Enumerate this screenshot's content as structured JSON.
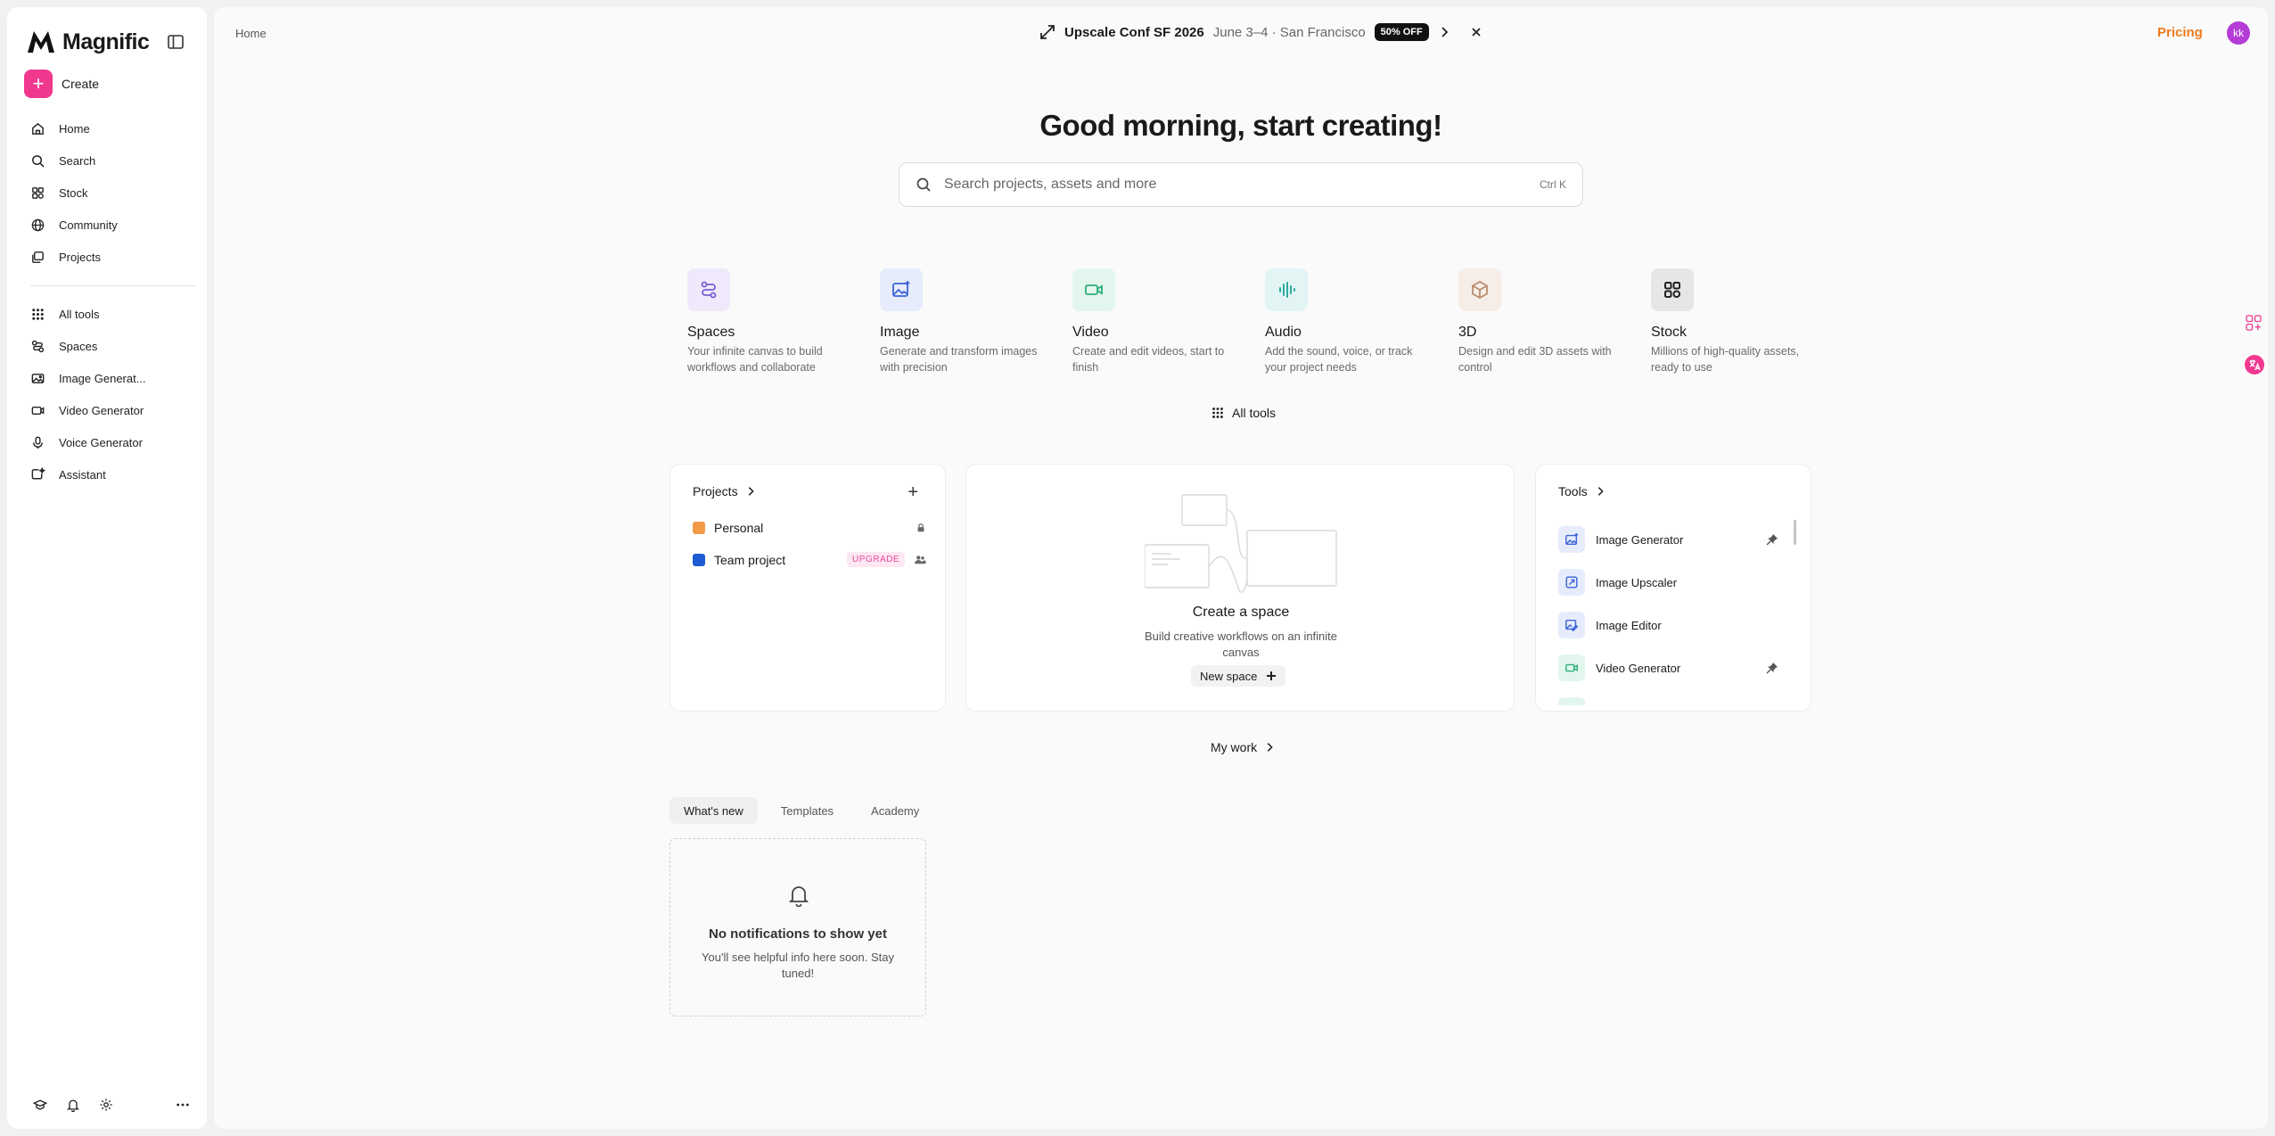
{
  "sidebar": {
    "brand": "Magnific",
    "create_label": "Create",
    "nav_primary": [
      {
        "label": "Home",
        "icon": "home-icon"
      },
      {
        "label": "Search",
        "icon": "search-icon"
      },
      {
        "label": "Stock",
        "icon": "stock-icon"
      },
      {
        "label": "Community",
        "icon": "globe-icon"
      },
      {
        "label": "Projects",
        "icon": "projects-icon"
      }
    ],
    "nav_tools": [
      {
        "label": "All tools",
        "icon": "grid-icon"
      },
      {
        "label": "Spaces",
        "icon": "spaces-icon"
      },
      {
        "label": "Image Generat...",
        "icon": "image-icon"
      },
      {
        "label": "Video Generator",
        "icon": "video-icon"
      },
      {
        "label": "Voice Generator",
        "icon": "mic-icon"
      },
      {
        "label": "Assistant",
        "icon": "assistant-icon"
      }
    ]
  },
  "header": {
    "breadcrumb": "Home",
    "banner_title": "Upscale Conf SF 2026",
    "banner_sub": "June 3–4 · San Francisco",
    "banner_badge": "50% OFF",
    "pricing": "Pricing",
    "avatar": "kk"
  },
  "hero": {
    "headline": "Good morning, start creating!",
    "search_placeholder": "Search projects, assets and more",
    "search_shortcut": "Ctrl K"
  },
  "categories": [
    {
      "title": "Spaces",
      "desc": "Your infinite canvas to build workflows and collaborate",
      "color": "#efe9fb",
      "accent": "#7b5cd6"
    },
    {
      "title": "Image",
      "desc": "Generate and transform images with precision",
      "color": "#e6ecfb",
      "accent": "#3d63d8"
    },
    {
      "title": "Video",
      "desc": "Create and edit videos, start to finish",
      "color": "#e3f6ee",
      "accent": "#2cae7a"
    },
    {
      "title": "Audio",
      "desc": "Add the sound, voice, or track your project needs",
      "color": "#e2f5f4",
      "accent": "#2aa9a2"
    },
    {
      "title": "3D",
      "desc": "Design and edit 3D assets with control",
      "color": "#f6ede7",
      "accent": "#b98b6c"
    },
    {
      "title": "Stock",
      "desc": "Millions of high-quality assets, ready to use",
      "color": "#ececec",
      "accent": "#222222"
    }
  ],
  "all_tools_label": "All tools",
  "projects_card": {
    "title": "Projects",
    "items": [
      {
        "name": "Personal",
        "color": "#f39a4a"
      },
      {
        "name": "Team project",
        "color": "#1e5bd6",
        "badge": "UPGRADE"
      }
    ]
  },
  "space_card": {
    "title": "Create a space",
    "desc": "Build creative workflows on an infinite canvas",
    "button": "New space"
  },
  "tools_card": {
    "title": "Tools",
    "items": [
      {
        "name": "Image Generator",
        "pinned": true
      },
      {
        "name": "Image Upscaler",
        "pinned": false
      },
      {
        "name": "Image Editor",
        "pinned": false
      },
      {
        "name": "Video Generator",
        "pinned": true
      }
    ]
  },
  "my_work": "My work",
  "tabs": [
    "What's new",
    "Templates",
    "Academy"
  ],
  "notifications": {
    "title": "No notifications to show yet",
    "desc": "You'll see helpful info here soon. Stay tuned!"
  }
}
